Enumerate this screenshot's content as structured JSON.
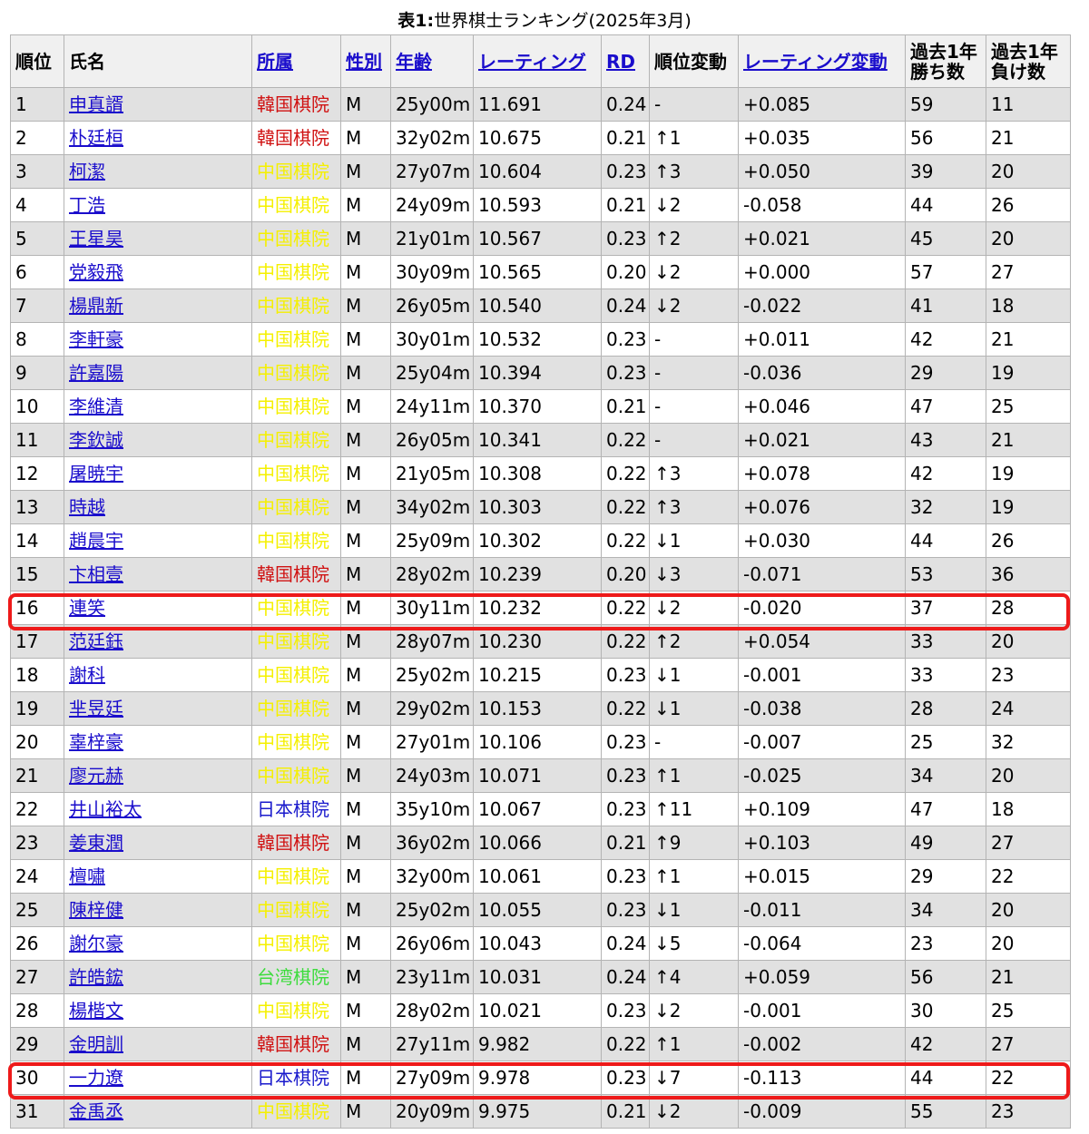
{
  "caption": {
    "bold": "表1:",
    "text": "世界棋士ランキング(2025年3月)"
  },
  "columns": {
    "rank": "順位",
    "name": "氏名",
    "affiliation": "所属",
    "gender": "性別",
    "age": "年齢",
    "rating": "レーティング",
    "rd": "RD",
    "rank_change": "順位変動",
    "rating_change": "レーティング変動",
    "wins_l1": "過去1年",
    "wins_l2": "勝ち数",
    "losses_l1": "過去1年",
    "losses_l2": "負け数"
  },
  "colors": {
    "韓国棋院": "#d01212",
    "中国棋院": "#f5f000",
    "日本棋院": "#1a1acc",
    "台湾棋院": "#3ddc3d",
    "highlight": "#ee1a1a"
  },
  "rows": [
    [
      "1",
      "申真諝",
      "韓国棋院",
      "M",
      "25y00m",
      "11.691",
      "0.24",
      "-",
      "+0.085",
      "59",
      "11"
    ],
    [
      "2",
      "朴廷桓",
      "韓国棋院",
      "M",
      "32y02m",
      "10.675",
      "0.21",
      "↑1",
      "+0.035",
      "56",
      "21"
    ],
    [
      "3",
      "柯潔",
      "中国棋院",
      "M",
      "27y07m",
      "10.604",
      "0.23",
      "↑3",
      "+0.050",
      "39",
      "20"
    ],
    [
      "4",
      "丁浩",
      "中国棋院",
      "M",
      "24y09m",
      "10.593",
      "0.21",
      "↓2",
      "-0.058",
      "44",
      "26"
    ],
    [
      "5",
      "王星昊",
      "中国棋院",
      "M",
      "21y01m",
      "10.567",
      "0.23",
      "↑2",
      "+0.021",
      "45",
      "20"
    ],
    [
      "6",
      "党毅飛",
      "中国棋院",
      "M",
      "30y09m",
      "10.565",
      "0.20",
      "↓2",
      "+0.000",
      "57",
      "27"
    ],
    [
      "7",
      "楊鼎新",
      "中国棋院",
      "M",
      "26y05m",
      "10.540",
      "0.24",
      "↓2",
      "-0.022",
      "41",
      "18"
    ],
    [
      "8",
      "李軒豪",
      "中国棋院",
      "M",
      "30y01m",
      "10.532",
      "0.23",
      "-",
      "+0.011",
      "42",
      "21"
    ],
    [
      "9",
      "許嘉陽",
      "中国棋院",
      "M",
      "25y04m",
      "10.394",
      "0.23",
      "-",
      "-0.036",
      "29",
      "19"
    ],
    [
      "10",
      "李維清",
      "中国棋院",
      "M",
      "24y11m",
      "10.370",
      "0.21",
      "-",
      "+0.046",
      "47",
      "25"
    ],
    [
      "11",
      "李欽誠",
      "中国棋院",
      "M",
      "26y05m",
      "10.341",
      "0.22",
      "-",
      "+0.021",
      "43",
      "21"
    ],
    [
      "12",
      "屠暁宇",
      "中国棋院",
      "M",
      "21y05m",
      "10.308",
      "0.22",
      "↑3",
      "+0.078",
      "42",
      "19"
    ],
    [
      "13",
      "時越",
      "中国棋院",
      "M",
      "34y02m",
      "10.303",
      "0.22",
      "↑3",
      "+0.076",
      "32",
      "19"
    ],
    [
      "14",
      "趙晨宇",
      "中国棋院",
      "M",
      "25y09m",
      "10.302",
      "0.22",
      "↓1",
      "+0.030",
      "44",
      "26"
    ],
    [
      "15",
      "卞相壹",
      "韓国棋院",
      "M",
      "28y02m",
      "10.239",
      "0.20",
      "↓3",
      "-0.071",
      "53",
      "36"
    ],
    [
      "16",
      "連笑",
      "中国棋院",
      "M",
      "30y11m",
      "10.232",
      "0.22",
      "↓2",
      "-0.020",
      "37",
      "28"
    ],
    [
      "17",
      "范廷鈺",
      "中国棋院",
      "M",
      "28y07m",
      "10.230",
      "0.22",
      "↑2",
      "+0.054",
      "33",
      "20"
    ],
    [
      "18",
      "謝科",
      "中国棋院",
      "M",
      "25y02m",
      "10.215",
      "0.23",
      "↓1",
      "-0.001",
      "33",
      "23"
    ],
    [
      "19",
      "芈昱廷",
      "中国棋院",
      "M",
      "29y02m",
      "10.153",
      "0.22",
      "↓1",
      "-0.038",
      "28",
      "24"
    ],
    [
      "20",
      "辜梓豪",
      "中国棋院",
      "M",
      "27y01m",
      "10.106",
      "0.23",
      "-",
      "-0.007",
      "25",
      "32"
    ],
    [
      "21",
      "廖元赫",
      "中国棋院",
      "M",
      "24y03m",
      "10.071",
      "0.23",
      "↑1",
      "-0.025",
      "34",
      "20"
    ],
    [
      "22",
      "井山裕太",
      "日本棋院",
      "M",
      "35y10m",
      "10.067",
      "0.23",
      "↑11",
      "+0.109",
      "47",
      "18"
    ],
    [
      "23",
      "姜東潤",
      "韓国棋院",
      "M",
      "36y02m",
      "10.066",
      "0.21",
      "↑9",
      "+0.103",
      "49",
      "27"
    ],
    [
      "24",
      "檀嘯",
      "中国棋院",
      "M",
      "32y00m",
      "10.061",
      "0.23",
      "↑1",
      "+0.015",
      "29",
      "22"
    ],
    [
      "25",
      "陳梓健",
      "中国棋院",
      "M",
      "25y02m",
      "10.055",
      "0.23",
      "↓1",
      "-0.011",
      "34",
      "20"
    ],
    [
      "26",
      "謝尔豪",
      "中国棋院",
      "M",
      "26y06m",
      "10.043",
      "0.24",
      "↓5",
      "-0.064",
      "23",
      "20"
    ],
    [
      "27",
      "許皓鋐",
      "台湾棋院",
      "M",
      "23y11m",
      "10.031",
      "0.24",
      "↑4",
      "+0.059",
      "56",
      "21"
    ],
    [
      "28",
      "楊楷文",
      "中国棋院",
      "M",
      "28y02m",
      "10.021",
      "0.23",
      "↓2",
      "-0.001",
      "30",
      "25"
    ],
    [
      "29",
      "金明訓",
      "韓国棋院",
      "M",
      "27y11m",
      "9.982",
      "0.22",
      "↑1",
      "-0.002",
      "42",
      "27"
    ],
    [
      "30",
      "一力遼",
      "日本棋院",
      "M",
      "27y09m",
      "9.978",
      "0.23",
      "↓7",
      "-0.113",
      "44",
      "22"
    ],
    [
      "31",
      "金禹丞",
      "中国棋院",
      "M",
      "20y09m",
      "9.975",
      "0.21",
      "↓2",
      "-0.009",
      "55",
      "23"
    ]
  ]
}
